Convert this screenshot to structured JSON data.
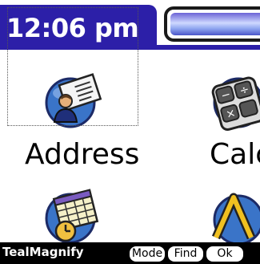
{
  "statusbar": {
    "time": "12:06 pm"
  },
  "apps": [
    {
      "label": "Address",
      "icon": "address-book-icon"
    },
    {
      "label": "Calc",
      "icon": "calculator-icon"
    },
    {
      "label": "",
      "icon": "datebook-icon"
    },
    {
      "label": "",
      "icon": "hotsync-icon"
    }
  ],
  "magnifier": {
    "brand": "TealMagnify",
    "buttons": {
      "mode": "Mode",
      "find": "Find",
      "ok": "Ok"
    }
  },
  "colors": {
    "title_bar": "#2c1fa8",
    "icon_circle": "#3a74c8",
    "battery_fill": "#8fa6f0",
    "bottom_bar": "#000000"
  }
}
